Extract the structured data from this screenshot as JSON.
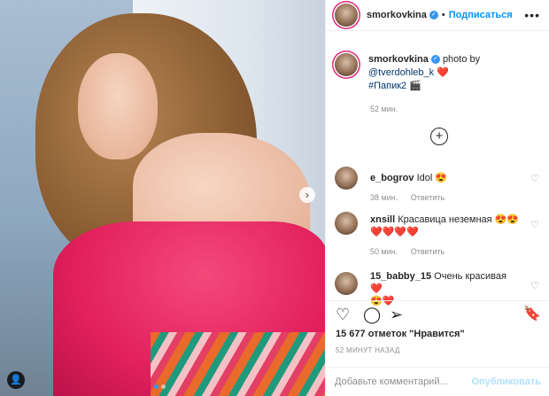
{
  "post": {
    "image_dots": 2,
    "next_arrow": "›",
    "tag_icon": "👤"
  },
  "header": {
    "username": "smorkovkina",
    "follow": "Подписаться",
    "more": "•••",
    "separator": "•"
  },
  "caption": {
    "username": "smorkovkina",
    "text_before": "photo by",
    "mention": "@tverdohleb_k",
    "mention_emoji": "❤️",
    "hashtag": "#Папик2",
    "hashtag_emoji": "🎬",
    "time": "52 мин."
  },
  "load_more": "+",
  "comments": [
    {
      "username": "e_bogrov",
      "text": "Idol",
      "emoji": "😍",
      "emoji_line": "",
      "time": "38 мин.",
      "reply": "Ответить"
    },
    {
      "username": "xnsill",
      "text": "Красавица неземная",
      "emoji": "😍😍",
      "emoji_line": "❤️❤️❤️❤️",
      "time": "50 мин.",
      "reply": "Ответить"
    },
    {
      "username": "15_babby_15",
      "text": "Очень красивая",
      "emoji": "❤️",
      "emoji_line": "😍❤️",
      "time": "",
      "reply": ""
    }
  ],
  "actions": {
    "like": "♡",
    "comment": "◯",
    "share": "➢",
    "save": "🔖"
  },
  "likes": "15 677 отметок \"Нравится\"",
  "posted": "52 МИНУТ НАЗАД",
  "add_comment": {
    "placeholder": "Добавьте комментарий...",
    "publish": "Опубликовать"
  },
  "colors": {
    "accent": "#0095f6",
    "verified": "#3897f0",
    "publish_disabled": "#b2dffc"
  }
}
